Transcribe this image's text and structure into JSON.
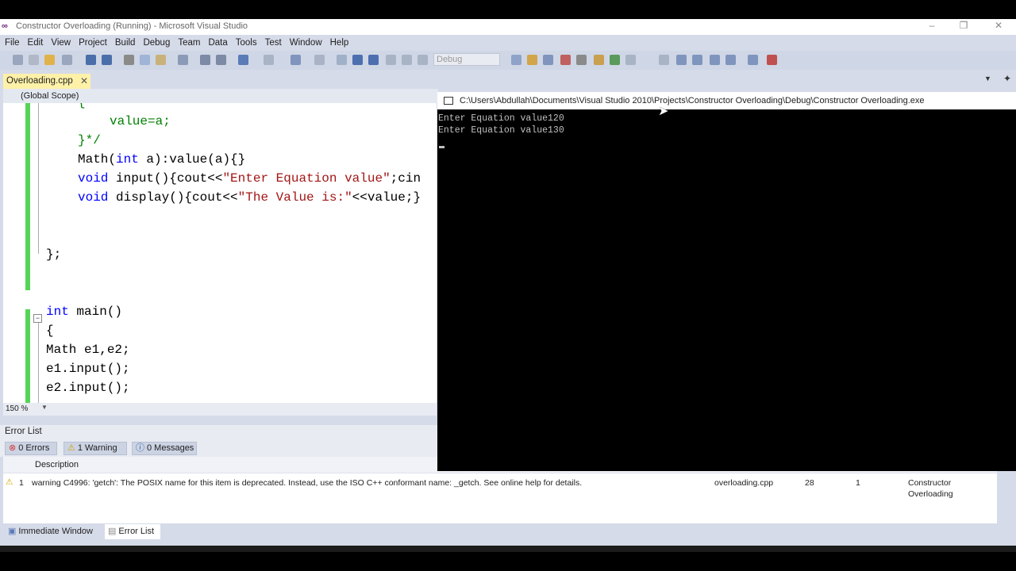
{
  "window": {
    "title": "Constructor Overloading (Running) - Microsoft Visual Studio",
    "logo_text": "∞"
  },
  "menu": [
    "File",
    "Edit",
    "View",
    "Project",
    "Build",
    "Debug",
    "Team",
    "Data",
    "Tools",
    "Test",
    "Window",
    "Help"
  ],
  "toolbar": {
    "configuration": "Debug"
  },
  "tabs": {
    "active_file": "Overloading.cpp",
    "close_glyph": "✕"
  },
  "scope": {
    "label": "(Global Scope)"
  },
  "editor": {
    "zoom": "150 %",
    "lines": {
      "l1": "{",
      "l2": "value=a;",
      "l3": "}*/",
      "l4a": "Math(",
      "l4b": "int",
      "l4c": " a):value(a){}",
      "l5a": "void",
      "l5b": " input(){cout<<",
      "l5c": "\"Enter Equation value\"",
      "l5d": ";cin",
      "l6a": "void",
      "l6b": " display(){cout<<",
      "l6c": "\"The Value is:\"",
      "l6d": "<<value;}",
      "l7": "};",
      "l8a": "int",
      "l8b": " main()",
      "l9": "{",
      "l10": "Math e1,e2;",
      "l11": "e1.input();",
      "l12": "e2.input();"
    }
  },
  "console": {
    "path": "C:\\Users\\Abdullah\\Documents\\Visual Studio 2010\\Projects\\Constructor Overloading\\Debug\\Constructor Overloading.exe",
    "output": [
      "Enter Equation value120",
      "Enter Equation value130"
    ]
  },
  "error_list": {
    "title": "Error List",
    "errors": "0 Errors",
    "warnings": "1 Warning",
    "messages": "0 Messages",
    "column_description": "Description",
    "row": {
      "index": "1",
      "description": "warning C4996: 'getch': The POSIX name for this item is deprecated. Instead, use the ISO C++ conformant name: _getch. See online help for details.",
      "file": "overloading.cpp",
      "line": "28",
      "column": "1",
      "project_line1": "Constructor",
      "project_line2": "Overloading"
    }
  },
  "bottom_tabs": [
    "Immediate Window",
    "Error List"
  ],
  "colors": {
    "accent_tab": "#fff1a8",
    "margin_green": "#55d455",
    "keyword": "#0000ff",
    "string": "#a31515",
    "comment": "#008000"
  }
}
